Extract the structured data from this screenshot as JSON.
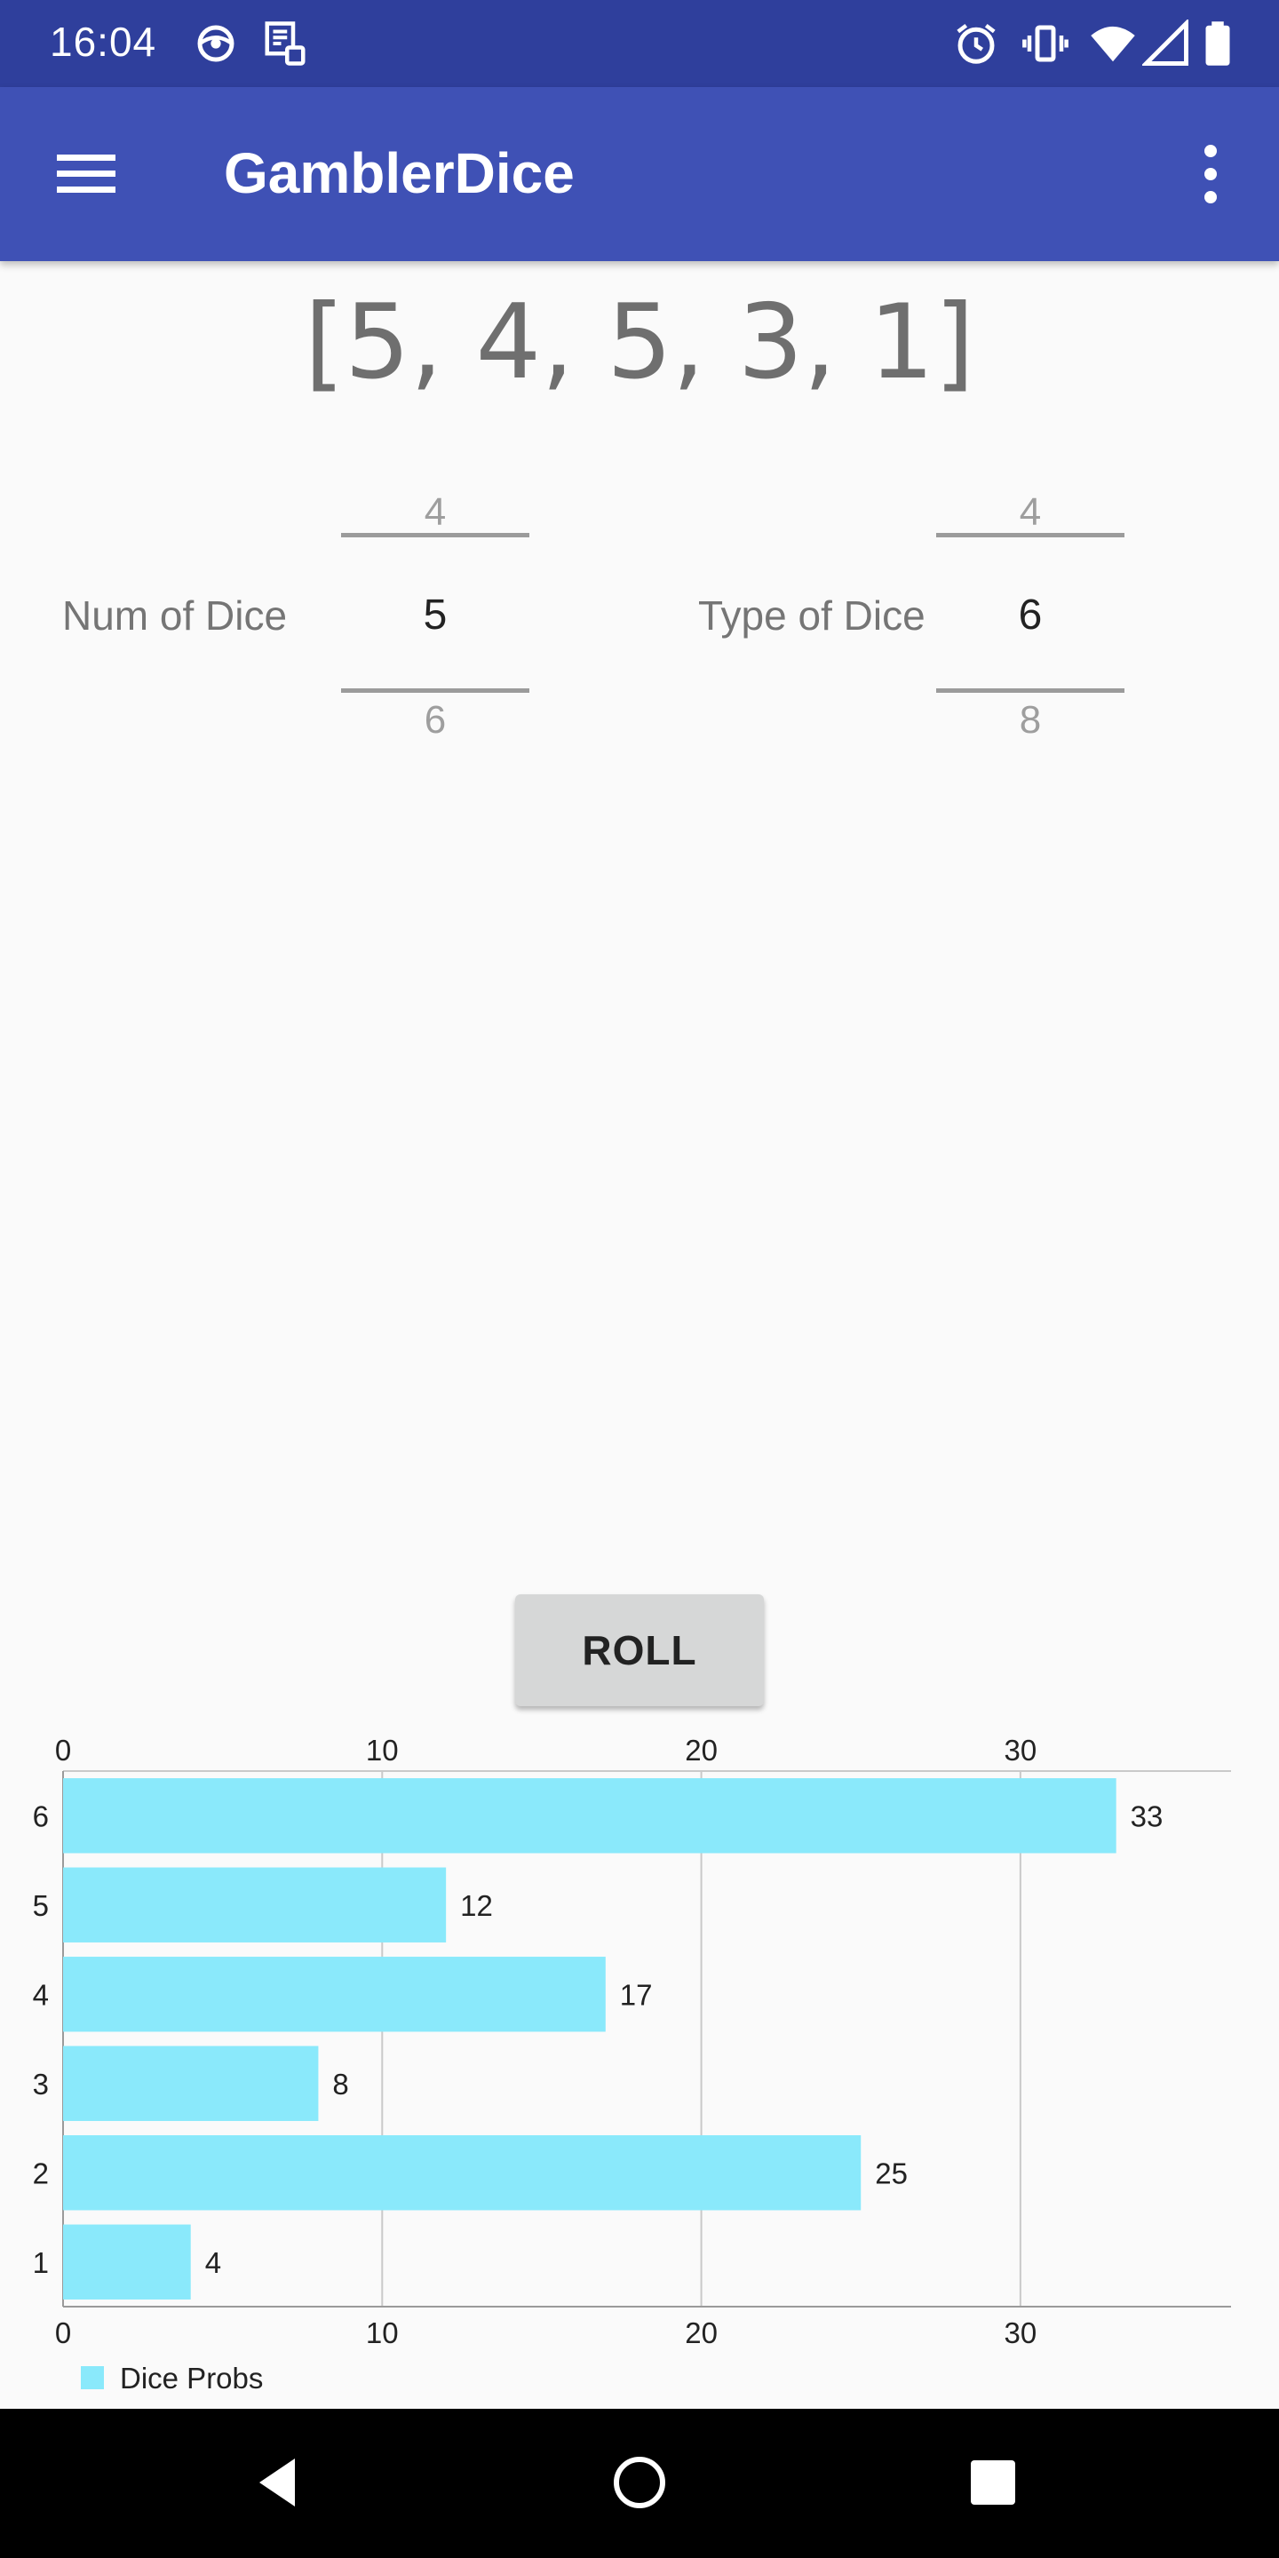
{
  "status_bar": {
    "time": "16:04",
    "left_icons": [
      "vpn-globe-icon",
      "sync-apps-icon"
    ],
    "right_icons": [
      "alarm-icon",
      "vibrate-icon",
      "wifi-icon",
      "cell-signal-icon",
      "battery-icon"
    ]
  },
  "app_bar": {
    "title": "GamblerDice",
    "menu_icon": "hamburger-menu-icon",
    "overflow_icon": "more-vert-icon"
  },
  "result_text": "[5, 4, 5, 3, 1]",
  "num_picker": {
    "label": "Num of Dice",
    "prev": "4",
    "current": "5",
    "next": "6"
  },
  "type_picker": {
    "label": "Type of Dice",
    "prev": "4",
    "current": "6",
    "next": "8"
  },
  "roll_button": "ROLL",
  "chart_data": {
    "type": "bar",
    "orientation": "horizontal",
    "categories": [
      "1",
      "2",
      "3",
      "4",
      "5",
      "6"
    ],
    "series": [
      {
        "name": "Dice Probs",
        "values": [
          4,
          25,
          8,
          17,
          12,
          33
        ],
        "color": "#8ae9fb"
      }
    ],
    "xlim": [
      0,
      36.6
    ],
    "x_ticks": [
      "0",
      "10",
      "20",
      "30"
    ],
    "x_tick_values": [
      0,
      10,
      20,
      30
    ],
    "data_labels": [
      "4",
      "25",
      "8",
      "17",
      "12",
      "33"
    ],
    "grid": true,
    "legend": "bottom-left"
  },
  "nav_bar": {
    "icons": [
      "back-icon",
      "home-icon",
      "recents-icon"
    ]
  }
}
